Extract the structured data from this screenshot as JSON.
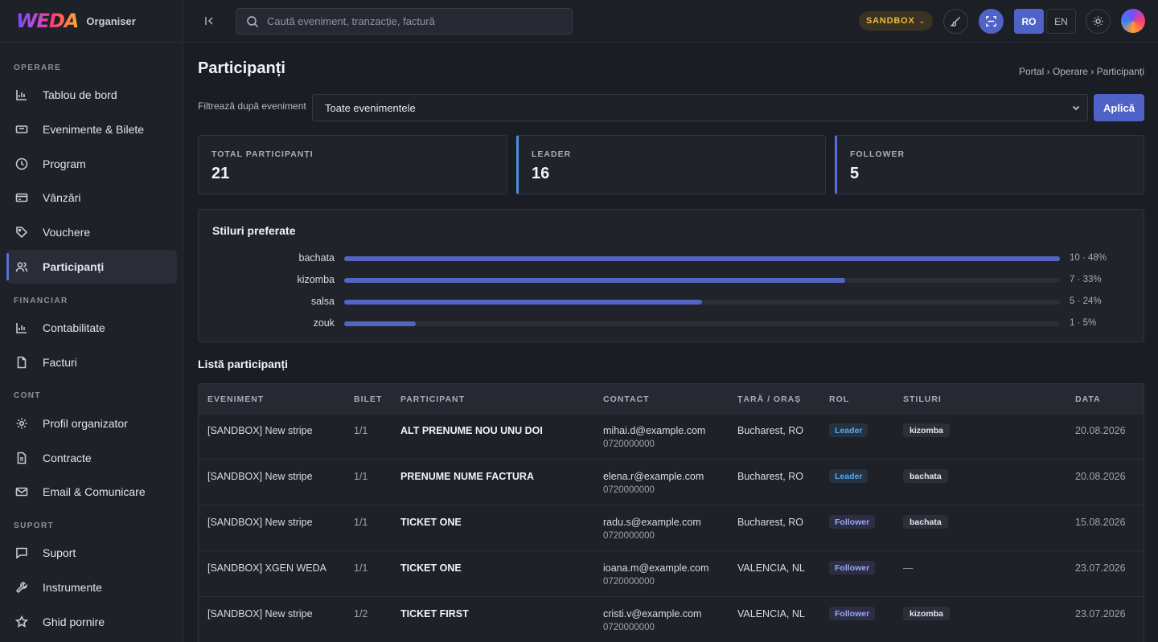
{
  "brand": {
    "logo": "WEDA",
    "subtitle": "Organiser"
  },
  "sidebar": {
    "sections": [
      {
        "title": "OPERARE",
        "items": [
          {
            "label": "Tablou de bord",
            "icon": "bar-chart-icon"
          },
          {
            "label": "Evenimente & Bilete",
            "icon": "ticket-icon"
          },
          {
            "label": "Program",
            "icon": "clock-icon"
          },
          {
            "label": "Vânzări",
            "icon": "card-icon"
          },
          {
            "label": "Vouchere",
            "icon": "tag-icon"
          },
          {
            "label": "Participanți",
            "icon": "users-icon",
            "active": true
          }
        ]
      },
      {
        "title": "FINANCIAR",
        "items": [
          {
            "label": "Contabilitate",
            "icon": "bar-chart-icon"
          },
          {
            "label": "Facturi",
            "icon": "file-icon"
          }
        ]
      },
      {
        "title": "CONT",
        "items": [
          {
            "label": "Profil organizator",
            "icon": "gear-icon"
          },
          {
            "label": "Contracte",
            "icon": "document-icon"
          },
          {
            "label": "Email & Comunicare",
            "icon": "mail-icon"
          }
        ]
      },
      {
        "title": "SUPORT",
        "items": [
          {
            "label": "Suport",
            "icon": "chat-icon"
          },
          {
            "label": "Instrumente",
            "icon": "wrench-icon"
          },
          {
            "label": "Ghid pornire",
            "icon": "star-icon"
          }
        ]
      }
    ]
  },
  "topbar": {
    "search_placeholder": "Caută eveniment, tranzacție, factură",
    "env_badge": "SANDBOX",
    "lang_ro": "RO",
    "lang_en": "EN"
  },
  "page": {
    "title": "Participanți",
    "breadcrumb": "Portal › Operare › Participanți",
    "filter_label": "Filtrează după eveniment",
    "filter_value": "Toate evenimentele",
    "apply_label": "Aplică"
  },
  "stats": [
    {
      "label": "TOTAL PARTICIPANȚI",
      "value": "21"
    },
    {
      "label": "LEADER",
      "value": "16"
    },
    {
      "label": "FOLLOWER",
      "value": "5"
    }
  ],
  "styles_card": {
    "title": "Stiluri preferate",
    "items": [
      {
        "name": "bachata",
        "stat": "10 · 48%",
        "fraction": 1.0
      },
      {
        "name": "kizomba",
        "stat": "7 · 33%",
        "fraction": 0.7
      },
      {
        "name": "salsa",
        "stat": "5 · 24%",
        "fraction": 0.5
      },
      {
        "name": "zouk",
        "stat": "1 · 5%",
        "fraction": 0.1
      }
    ]
  },
  "table": {
    "title": "Listă participanți",
    "headers": [
      "EVENIMENT",
      "BILET",
      "PARTICIPANT",
      "CONTACT",
      "ȚARĂ / ORAȘ",
      "ROL",
      "STILURI",
      "DATA"
    ],
    "rows": [
      {
        "event": "[SANDBOX] New stripe",
        "ticket": "1/1",
        "participant": "ALT PRENUME NOU UNU DOI",
        "email": "mihai.d@example.com",
        "phone": "0720000000",
        "location": "Bucharest, RO",
        "role": "Leader",
        "style": "kizomba",
        "date": "20.08.2026"
      },
      {
        "event": "[SANDBOX] New stripe",
        "ticket": "1/1",
        "participant": "PRENUME NUME FACTURA",
        "email": "elena.r@example.com",
        "phone": "0720000000",
        "location": "Bucharest, RO",
        "role": "Leader",
        "style": "bachata",
        "date": "20.08.2026"
      },
      {
        "event": "[SANDBOX] New stripe",
        "ticket": "1/1",
        "participant": "TICKET ONE",
        "email": "radu.s@example.com",
        "phone": "0720000000",
        "location": "Bucharest, RO",
        "role": "Follower",
        "style": "bachata",
        "date": "15.08.2026"
      },
      {
        "event": "[SANDBOX] XGEN WEDA",
        "ticket": "1/1",
        "participant": "TICKET ONE",
        "email": "ioana.m@example.com",
        "phone": "0720000000",
        "location": "VALENCIA, NL",
        "role": "Follower",
        "style": "—",
        "date": "23.07.2026"
      },
      {
        "event": "[SANDBOX] New stripe",
        "ticket": "1/2",
        "participant": "TICKET FIRST",
        "email": "cristi.v@example.com",
        "phone": "0720000000",
        "location": "VALENCIA, NL",
        "role": "Follower",
        "style": "kizomba",
        "date": "23.07.2026"
      }
    ]
  },
  "colors": {
    "accent": "#4f62c8",
    "leader": "#5aa6e6",
    "follower": "#9aa8f0",
    "sandbox": "#f0b940"
  }
}
